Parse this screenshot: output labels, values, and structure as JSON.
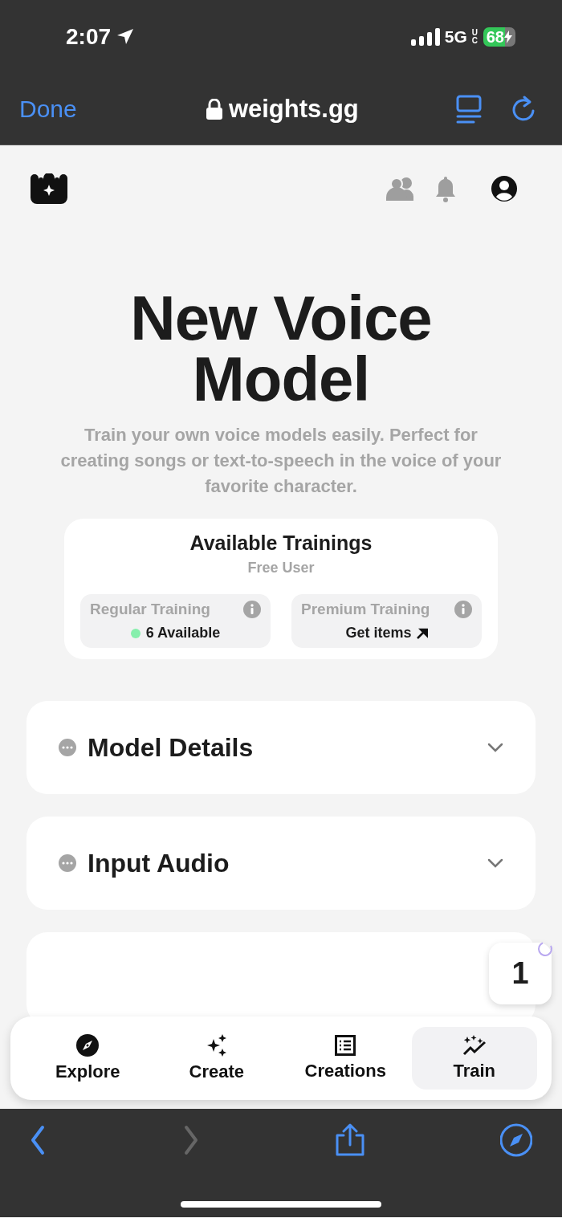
{
  "status_bar": {
    "time": "2:07",
    "network": "5G",
    "network_suffix": "UC",
    "battery": "68"
  },
  "browser_bar": {
    "done": "Done",
    "url": "weights.gg"
  },
  "page": {
    "title": "New Voice Model",
    "subtitle": "Train your own voice models easily. Perfect for creating songs or text-to-speech in the voice of your favorite character.",
    "trainings": {
      "title": "Available Trainings",
      "tier": "Free User",
      "options": [
        {
          "kind": "status",
          "label": "Regular Training",
          "value": "6 Available",
          "color": "#86efac"
        },
        {
          "kind": "link",
          "label": "Premium Training",
          "value": "Get items"
        }
      ]
    },
    "sections": [
      {
        "title": "Model Details",
        "expanded": false
      },
      {
        "title": "Input Audio",
        "expanded": false
      }
    ],
    "queue_badge": "1"
  },
  "nav": [
    {
      "label": "Explore",
      "selected": false
    },
    {
      "label": "Create",
      "selected": false
    },
    {
      "label": "Creations",
      "selected": false
    },
    {
      "label": "Train",
      "selected": true
    }
  ],
  "toolbar": [
    {
      "kind": "back",
      "disabled": false
    },
    {
      "kind": "forward",
      "disabled": true
    },
    {
      "kind": "share",
      "disabled": false
    },
    {
      "kind": "compass",
      "disabled": false
    }
  ]
}
